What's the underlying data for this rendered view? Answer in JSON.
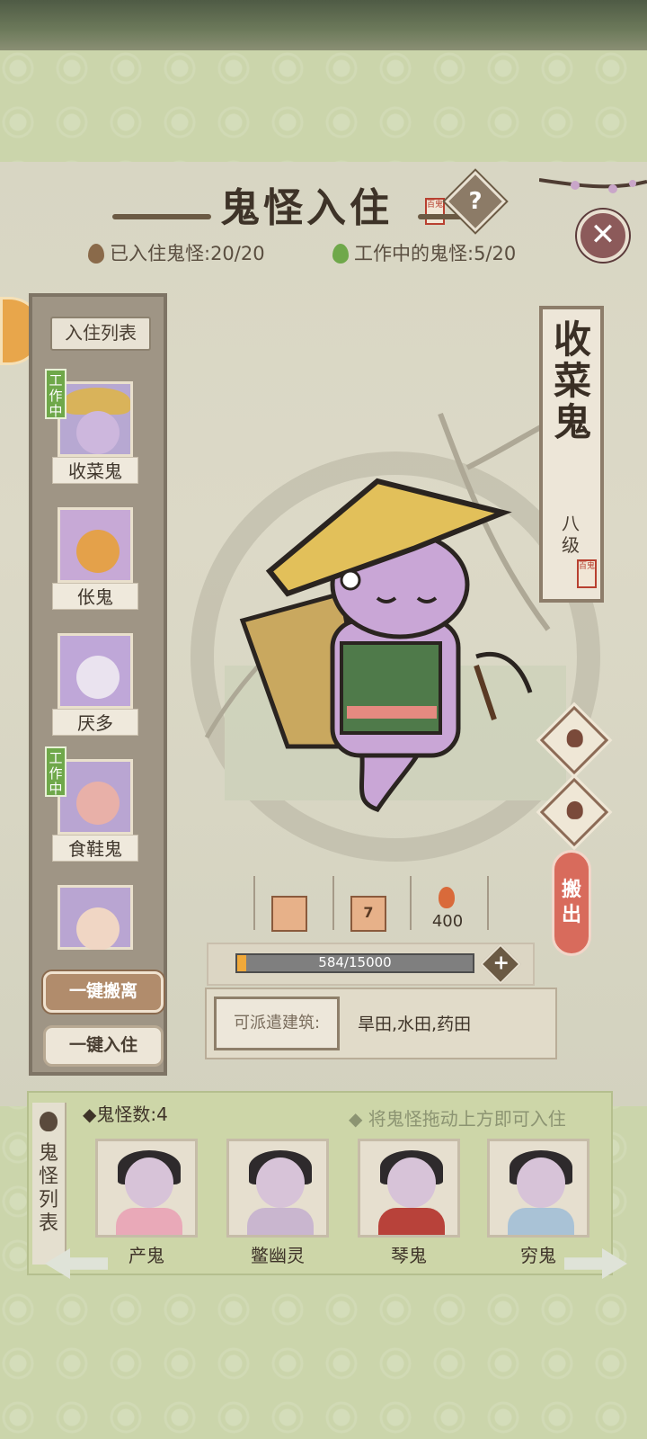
{
  "header": {
    "title": "鬼怪入住",
    "seal_text": "百鬼",
    "help_label": "?",
    "close_label": "✕"
  },
  "stats": {
    "settled": "已入住鬼怪:20/20",
    "working": "工作中的鬼怪:5/20"
  },
  "resident_list": {
    "tab_label": "入住列表",
    "items": [
      {
        "name": "收菜鬼",
        "working": true,
        "working_label": "工作中"
      },
      {
        "name": "伥鬼",
        "working": false
      },
      {
        "name": "厌多",
        "working": false
      },
      {
        "name": "食鞋鬼",
        "working": true,
        "working_label": "工作中"
      },
      {
        "name": "",
        "working": false
      }
    ],
    "move_all_label": "一键搬离",
    "settle_all_label": "一键入住"
  },
  "selected_ghost": {
    "name": "收菜鬼",
    "level": "八级",
    "seal_text": "百鬼",
    "move_out_label": "搬出",
    "resources": [
      {
        "icon": "e-token-icon",
        "value": ""
      },
      {
        "icon": "scroll-icon",
        "value": "7"
      },
      {
        "icon": "flame-icon",
        "value": "400"
      }
    ],
    "exp_text": "584/15000",
    "exp_fraction": 0.039,
    "assign_label": "可派遣建筑:",
    "assign_value": "旱田,水田,药田"
  },
  "ghost_list": {
    "side_label": "鬼怪列表",
    "count_label": "鬼怪数:4",
    "hint": "将鬼怪拖动上方即可入住",
    "items": [
      {
        "name": "产鬼",
        "body_color": "#e9a9b8"
      },
      {
        "name": "鳖幽灵",
        "body_color": "#c9b6cf"
      },
      {
        "name": "琴鬼",
        "body_color": "#b8423a"
      },
      {
        "name": "穷鬼",
        "body_color": "#a9c2d6"
      }
    ]
  },
  "colors": {
    "accent_green": "#6fa84a",
    "move_out_red": "#d86b5c",
    "progress_orange": "#f0a93a"
  }
}
